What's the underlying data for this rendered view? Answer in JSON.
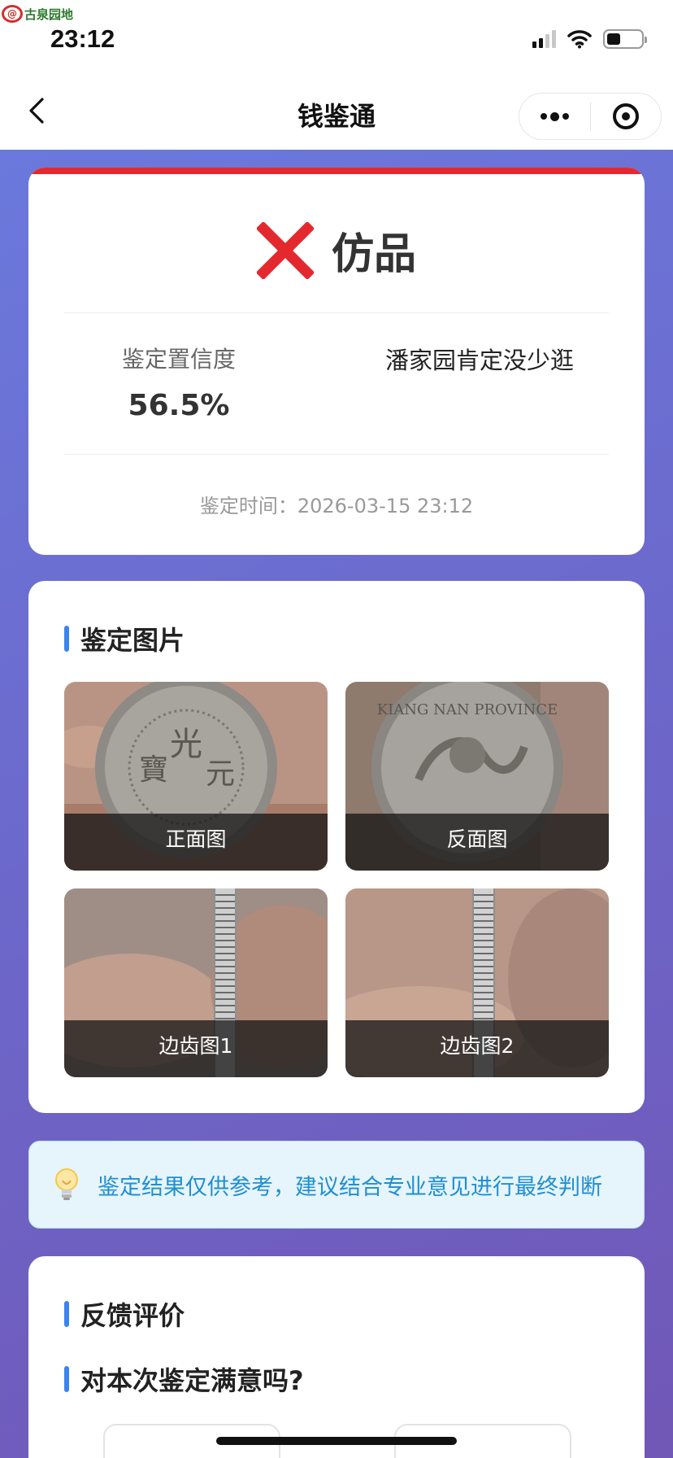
{
  "status_bar": {
    "watermark_text": "古泉园地",
    "time": "23:12"
  },
  "nav": {
    "title": "钱鉴通",
    "icons": [
      "back-arrow-icon",
      "more-dots-icon",
      "target-close-icon"
    ]
  },
  "result": {
    "verdict": "仿品",
    "verdict_icon": "red-cross-icon",
    "confidence_label": "鉴定置信度",
    "confidence_value": "56.5%",
    "comment": "潘家园肯定没少逛",
    "time_text": "鉴定时间：2026-03-15 23:12",
    "accent_color": "#e4292e"
  },
  "photos": {
    "title": "鉴定图片",
    "items": [
      {
        "caption": "正面图"
      },
      {
        "caption": "反面图"
      },
      {
        "caption": "边齿图1"
      },
      {
        "caption": "边齿图2"
      }
    ]
  },
  "notice": {
    "icon": "lightbulb-icon",
    "text": "鉴定结果仅供参考，建议结合专业意见进行最终判断",
    "color": "#1f8fd3"
  },
  "feedback": {
    "title": "反馈评价",
    "question": "对本次鉴定满意吗?"
  }
}
